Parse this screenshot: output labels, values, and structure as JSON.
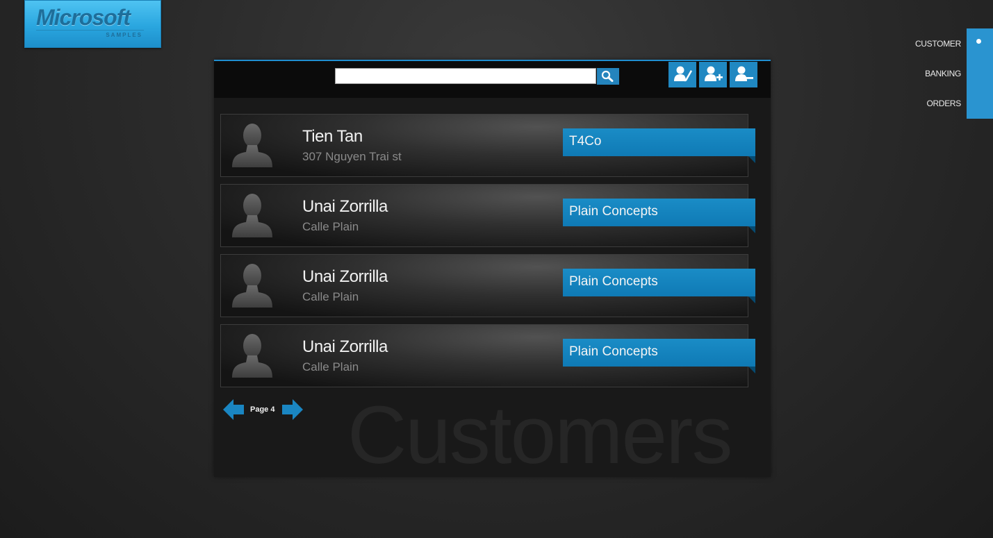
{
  "logo": {
    "word": "Microsoft",
    "sub": "SAMPLES"
  },
  "nav": {
    "items": [
      {
        "label": "CUSTOMER",
        "active": true
      },
      {
        "label": "BANKING",
        "active": false
      },
      {
        "label": "ORDERS",
        "active": false
      }
    ],
    "accent": "#2a94d0"
  },
  "toolbar": {
    "search": {
      "value": "",
      "placeholder": ""
    },
    "buttons": [
      "edit-user-icon",
      "add-user-icon",
      "remove-user-icon"
    ]
  },
  "customers": [
    {
      "name": "Tien Tan",
      "address": "307 Nguyen Trai st",
      "company": "T4Co"
    },
    {
      "name": "Unai Zorrilla",
      "address": "Calle Plain",
      "company": "Plain Concepts"
    },
    {
      "name": "Unai Zorrilla",
      "address": "Calle Plain",
      "company": "Plain Concepts"
    },
    {
      "name": "Unai Zorrilla",
      "address": "Calle Plain",
      "company": "Plain Concepts"
    }
  ],
  "pager": {
    "label": "Page 4"
  },
  "watermark": "Customers",
  "colors": {
    "accent": "#1f8ed0",
    "ribbon": "#0f7ab5",
    "background": "#2b2b2b"
  }
}
